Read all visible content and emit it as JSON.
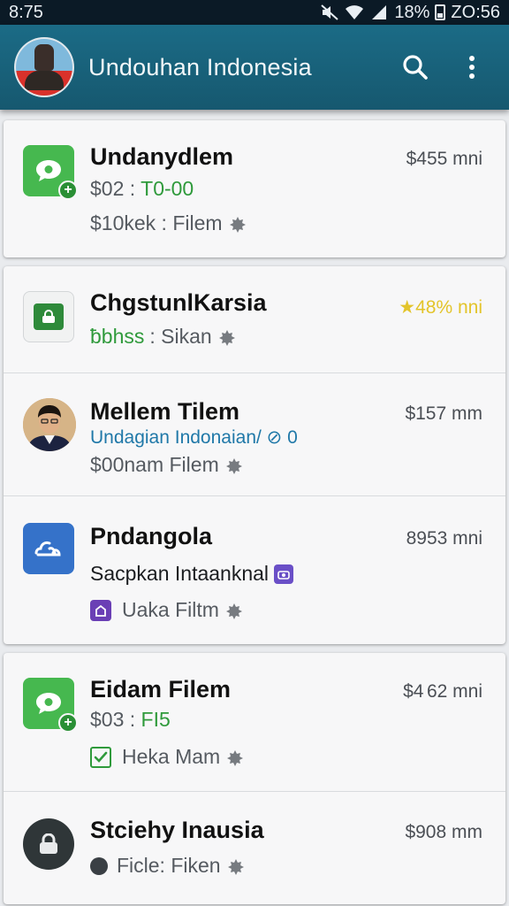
{
  "status_bar": {
    "time": "8:75",
    "battery": "18%",
    "clock": "ZO:56",
    "icons": [
      "mute-icon",
      "wifi-icon",
      "signal-icon",
      "battery-icon"
    ]
  },
  "app_bar": {
    "title": "Undouhan Indonesia",
    "icons": [
      "search-icon",
      "more-vert-icon"
    ]
  },
  "items": [
    {
      "title": "Undanydlem",
      "meta": "$455 mni",
      "line2_prefix": "$02 : ",
      "line2_value": "T0-00",
      "line3": "$10kek : Filem",
      "icon": "chat-bubble-icon"
    },
    {
      "title": "ChgstunlKarsia",
      "meta": "★48% nni",
      "line2_prefix": "ƀbhss",
      "line2_value": " : Sikan",
      "icon": "lock-icon"
    },
    {
      "title": "Mellem Tilem",
      "meta": "$157 mm",
      "line2": "Undagian Indonaian/ ⊘ 0",
      "line3": "$00nam Filem",
      "icon": "person-avatar"
    },
    {
      "title": "Pndangola",
      "meta": "8953 mni",
      "line2": "Sacpkan Intaanknal",
      "line3": "Uaka Filtm",
      "icon": "cloud-icon"
    },
    {
      "title": "Eidam Filem",
      "meta": "$4  62 mni",
      "line2_prefix": "$03 : ",
      "line2_value": "FI5",
      "line3": "Heka Mam",
      "icon": "chat-bubble-icon"
    },
    {
      "title": "Stciehy Inausia",
      "meta": "$908 mm",
      "line3": "Ficle: Fiken",
      "icon": "lock-icon"
    }
  ],
  "colors": {
    "app_bar": "#1b6b86",
    "green": "#46b84f",
    "blue": "#3572c9",
    "gold": "#e3c42a"
  }
}
